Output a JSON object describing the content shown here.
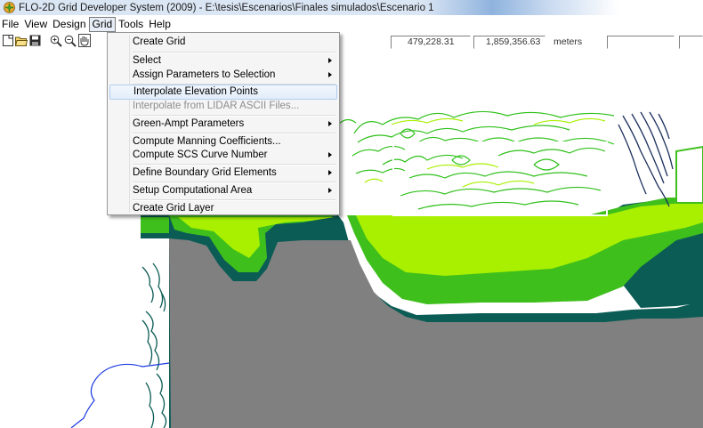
{
  "window": {
    "title": "FLO-2D Grid Developer System (2009) - E:\\tesis\\Escenarios\\Finales simulados\\Escenario 1",
    "icon": "flo2d-app-icon"
  },
  "menubar": {
    "items": [
      {
        "label": "File"
      },
      {
        "label": "View"
      },
      {
        "label": "Design"
      },
      {
        "label": "Grid"
      },
      {
        "label": "Tools"
      },
      {
        "label": "Help"
      }
    ],
    "open_menu": "Grid"
  },
  "toolbar": {
    "buttons": [
      "new-file-icon",
      "open-folder-icon",
      "save-icon",
      "zoom-in-icon",
      "zoom-out-icon",
      "pan-hand-icon"
    ],
    "coord_x": "479,228.31",
    "coord_y": "1,859,356.63",
    "units": "meters",
    "extra_field_1": "",
    "extra_field_2": ""
  },
  "grid_menu": {
    "items": [
      {
        "label": "Create Grid",
        "submenu": false,
        "disabled": false
      },
      {
        "label": "Select",
        "submenu": true,
        "disabled": false
      },
      {
        "label": "Assign Parameters to Selection",
        "submenu": true,
        "disabled": false
      },
      {
        "label": "Interpolate Elevation Points",
        "submenu": false,
        "disabled": false,
        "highlighted": true
      },
      {
        "label": "Interpolate from  LIDAR ASCII Files...",
        "submenu": false,
        "disabled": true
      },
      {
        "label": "Green-Ampt Parameters",
        "submenu": true,
        "disabled": false
      },
      {
        "label": "Compute Manning Coefficients...",
        "submenu": false,
        "disabled": false
      },
      {
        "label": "Compute SCS Curve Number",
        "submenu": true,
        "disabled": false
      },
      {
        "label": "Define Boundary Grid Elements",
        "submenu": true,
        "disabled": false
      },
      {
        "label": "Setup Computational Area",
        "submenu": true,
        "disabled": false
      },
      {
        "label": "Create Grid Layer",
        "submenu": false,
        "disabled": false
      }
    ]
  },
  "colors": {
    "grid_gray": "#808080",
    "dark_teal": "#0b5c55",
    "green": "#3fbf1c",
    "light_green": "#a8f000",
    "contour_green": "#2fc01a",
    "contour_navy": "#1b2f5c",
    "river_blue": "#1b39e0"
  }
}
